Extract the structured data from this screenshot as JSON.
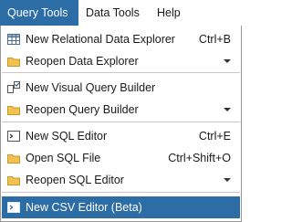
{
  "menubar": {
    "items": [
      {
        "label": "Query Tools"
      },
      {
        "label": "Data Tools"
      },
      {
        "label": "Help"
      }
    ]
  },
  "menu": {
    "items": [
      {
        "label": "New Relational Data Explorer",
        "shortcut": "Ctrl+B",
        "icon": "grid-icon"
      },
      {
        "label": "Reopen Data Explorer",
        "icon": "folder-icon",
        "submenu": true
      },
      {
        "label": "New Visual Query Builder",
        "icon": "visual-query-icon"
      },
      {
        "label": "Reopen Query Builder",
        "icon": "folder-icon",
        "submenu": true
      },
      {
        "label": "New SQL Editor",
        "shortcut": "Ctrl+E",
        "icon": "terminal-icon"
      },
      {
        "label": "Open SQL File",
        "shortcut": "Ctrl+Shift+O",
        "icon": "folder-icon"
      },
      {
        "label": "Reopen SQL Editor",
        "icon": "folder-icon",
        "submenu": true
      },
      {
        "label": "New CSV Editor (Beta)",
        "icon": "terminal-icon"
      }
    ]
  },
  "colors": {
    "accent": "#2d6da6",
    "folder": "#f2c24f"
  }
}
